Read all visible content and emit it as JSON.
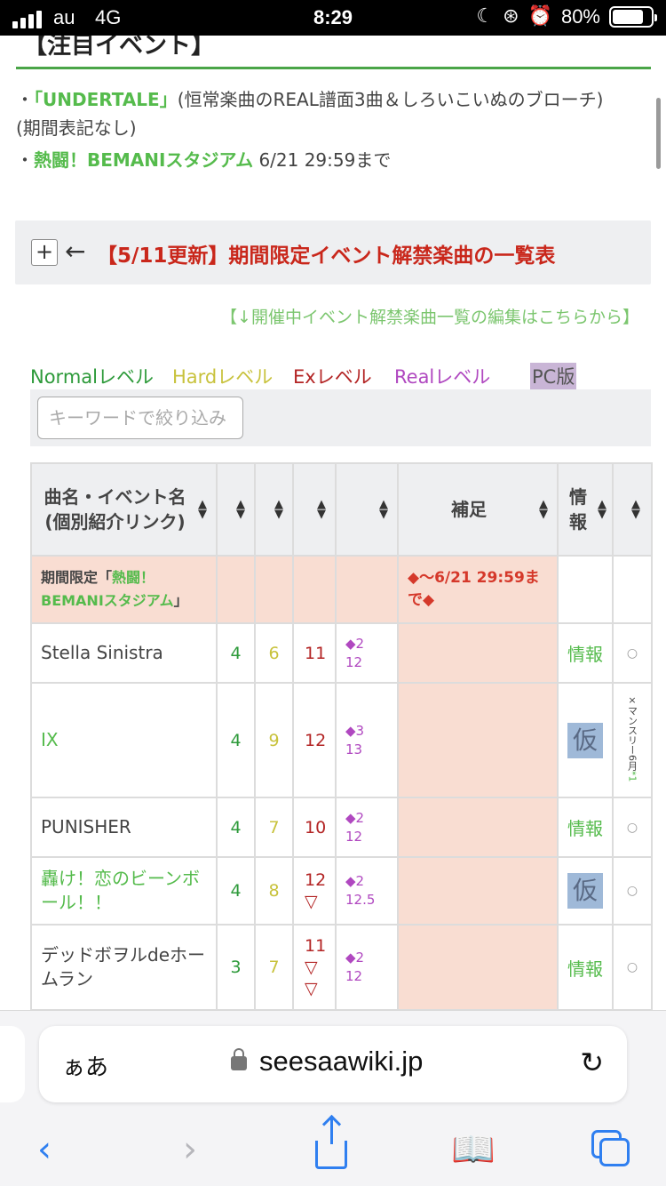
{
  "status_bar": {
    "carrier": "au",
    "network": "4G",
    "time": "8:29",
    "battery": "80%",
    "battery_level": 0.8,
    "icons": [
      "moon-icon",
      "orientation-lock-icon",
      "alarm-icon"
    ]
  },
  "page": {
    "section_title": "【注目イベント】",
    "notices": [
      {
        "bullet": "・",
        "link": "「UNDERTALE」",
        "text": "(恒常楽曲のREAL譜面3曲＆しろいこいぬのブローチ)　(期間表記なし)"
      },
      {
        "bullet": "・",
        "link": "熱闘！BEMANIスタジアム",
        "text": "6/21 29:59まで"
      }
    ],
    "fold": {
      "toggle": "+",
      "arrow": "←",
      "label": "【5/11更新】期間限定イベント解禁楽曲の一覧表"
    },
    "edit_link": "【↓開催中イベント解禁楽曲一覧の編集はこちらから】",
    "legend": {
      "normal": "Normalレベル",
      "hard": "Hardレベル",
      "ex": "Exレベル",
      "real": "Realレベル",
      "pc": "PC版"
    },
    "filter": {
      "placeholder": "キーワードで絞り込み"
    },
    "table": {
      "headers": {
        "name": "曲名・イベント名(個別紹介リンク)",
        "normal": "",
        "hard": "",
        "ex": "",
        "real": "",
        "note": "補足",
        "info": "情報",
        "pc": ""
      },
      "sort_icon": "⬍",
      "event_row": {
        "prefix": "期間限定「",
        "event_link": "熱闘！BEMANIスタジアム",
        "suffix": "」",
        "note": "◆〜6/21 29:59まで◆"
      },
      "rows": [
        {
          "title": "Stella Sinistra",
          "normal": "4",
          "hard": "6",
          "ex": "11",
          "ex_marks": [],
          "real": "◆2",
          "real_level": "12",
          "info": "情報",
          "pc": "○"
        },
        {
          "title": "IX",
          "normal": "4",
          "hard": "9",
          "ex": "12",
          "ex_marks": [],
          "real": "◆3",
          "real_level": "13",
          "info_image": "仮",
          "pc": "×マンスリー6月",
          "pc_note": "*1"
        },
        {
          "title": "PUNISHER",
          "normal": "4",
          "hard": "7",
          "ex": "10",
          "ex_marks": [],
          "real": "◆2",
          "real_level": "12",
          "info": "情報",
          "pc": "○"
        },
        {
          "title": "轟け！恋のビーンボール！！",
          "normal": "4",
          "hard": "8",
          "ex": "12",
          "ex_marks": [
            "▽"
          ],
          "real": "◆2",
          "real_level": "12.5",
          "info_image": "仮",
          "pc": "○"
        },
        {
          "title": "デッドボヲルdeホームラン",
          "normal": "3",
          "hard": "7",
          "ex": "11",
          "ex_marks": [
            "▽",
            "▽"
          ],
          "real": "◆2",
          "real_level": "12",
          "info": "情報",
          "pc": "○"
        }
      ]
    }
  },
  "browser": {
    "aa_label": "ぁあ",
    "domain": "seesaawiki.jp",
    "icons": [
      "lock-icon",
      "reload-icon",
      "back-icon",
      "forward-icon",
      "share-icon",
      "bookmarks-icon",
      "tabs-icon"
    ]
  },
  "colors": {
    "accent_green": "#55bb4c",
    "event_red": "#d5382a",
    "normal": "#2d9a3a",
    "hard": "#c8c23c",
    "ex": "#b32424",
    "real": "#b048c0",
    "pc_header": "#c9b5d6",
    "ios_blue": "#2f7ff0"
  }
}
